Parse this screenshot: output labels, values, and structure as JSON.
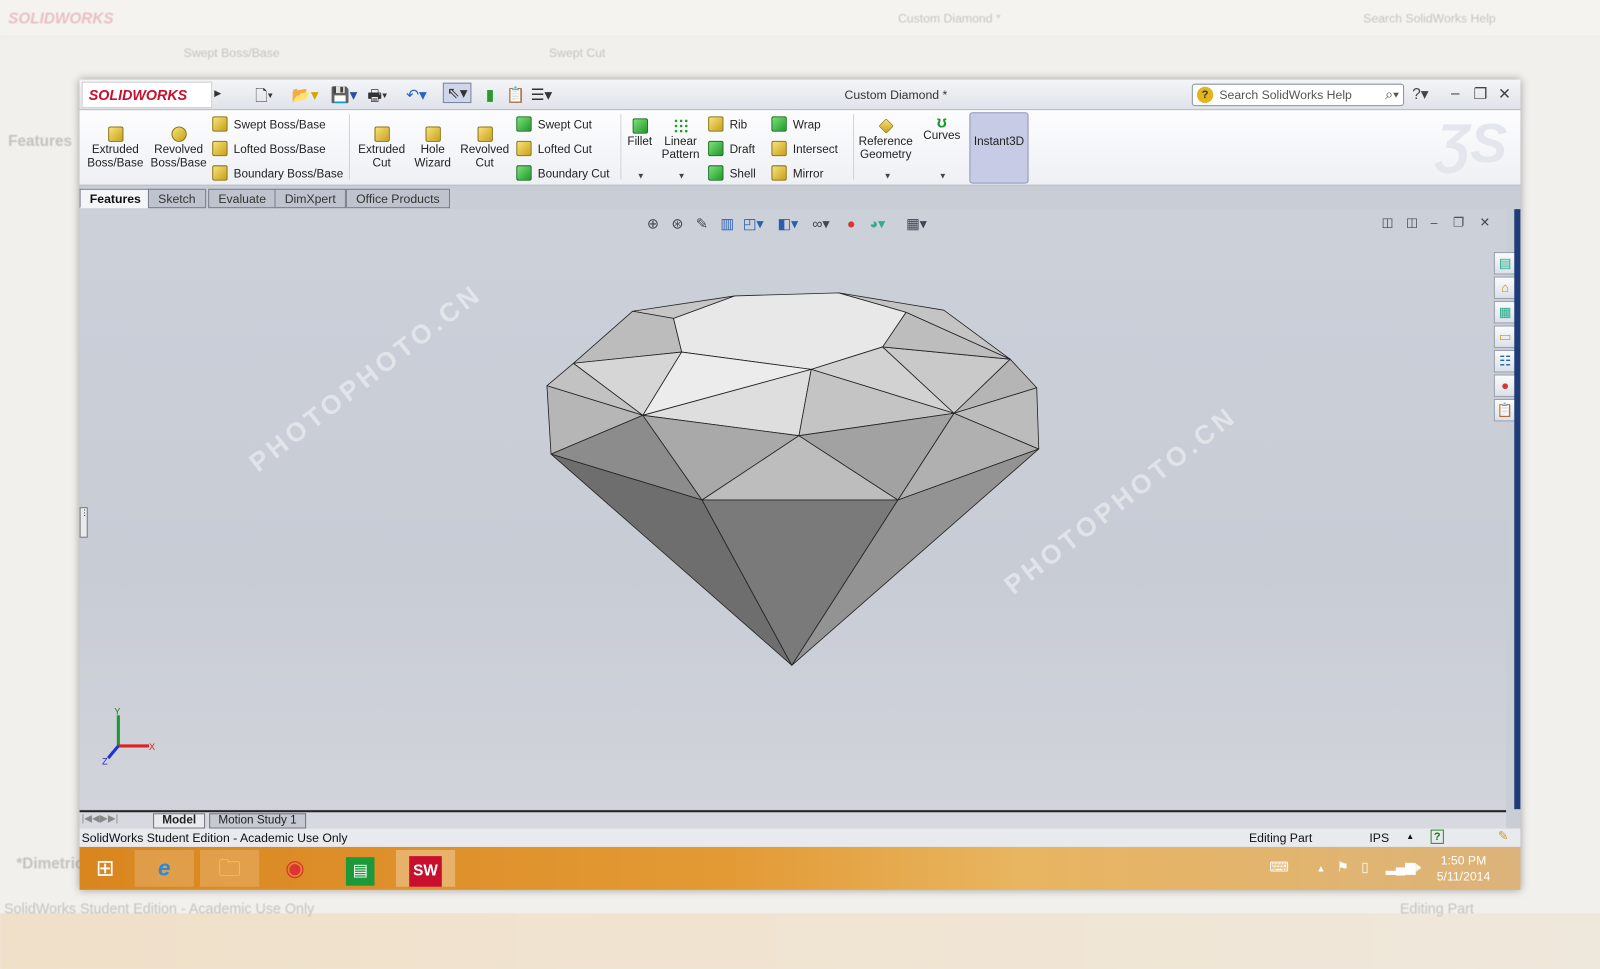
{
  "app": {
    "brand": "SOLIDWORKS",
    "title": "Custom Diamond *",
    "search_placeholder": "Search SolidWorks Help"
  },
  "ribbon": {
    "extruded_boss": "Extruded Boss/Base",
    "revolved_boss": "Revolved Boss/Base",
    "swept_boss": "Swept Boss/Base",
    "lofted_boss": "Lofted Boss/Base",
    "boundary_boss": "Boundary Boss/Base",
    "extruded_cut": "Extruded Cut",
    "hole_wizard": "Hole Wizard",
    "revolved_cut": "Revolved Cut",
    "swept_cut": "Swept Cut",
    "lofted_cut": "Lofted Cut",
    "boundary_cut": "Boundary Cut",
    "fillet": "Fillet",
    "linear_pattern": "Linear Pattern",
    "rib": "Rib",
    "draft": "Draft",
    "shell": "Shell",
    "wrap": "Wrap",
    "intersect": "Intersect",
    "mirror": "Mirror",
    "reference_geometry": "Reference Geometry",
    "curves": "Curves",
    "instant3d": "Instant3D"
  },
  "tabs": [
    {
      "label": "Features",
      "active": true
    },
    {
      "label": "Sketch"
    },
    {
      "label": "Evaluate"
    },
    {
      "label": "DimXpert"
    },
    {
      "label": "Office Products"
    }
  ],
  "viewport": {
    "view_name": "*Dimetric",
    "axis_x": "X",
    "axis_y": "Y",
    "axis_z": "Z",
    "watermark": "PHOTOPHOTO.CN"
  },
  "bottom_tabs": [
    {
      "label": "Model",
      "active": true
    },
    {
      "label": "Motion Study 1"
    }
  ],
  "status": {
    "left": "SolidWorks Student Edition - Academic Use Only",
    "mode": "Editing Part",
    "units": "IPS",
    "help": "?"
  },
  "taskbar": {
    "time": "1:50 PM",
    "date": "5/11/2014",
    "sw_label": "SW"
  },
  "colors": {
    "accent": "#c8102e",
    "taskbar": "#e39a35",
    "viewport": "#c9cdd6"
  }
}
